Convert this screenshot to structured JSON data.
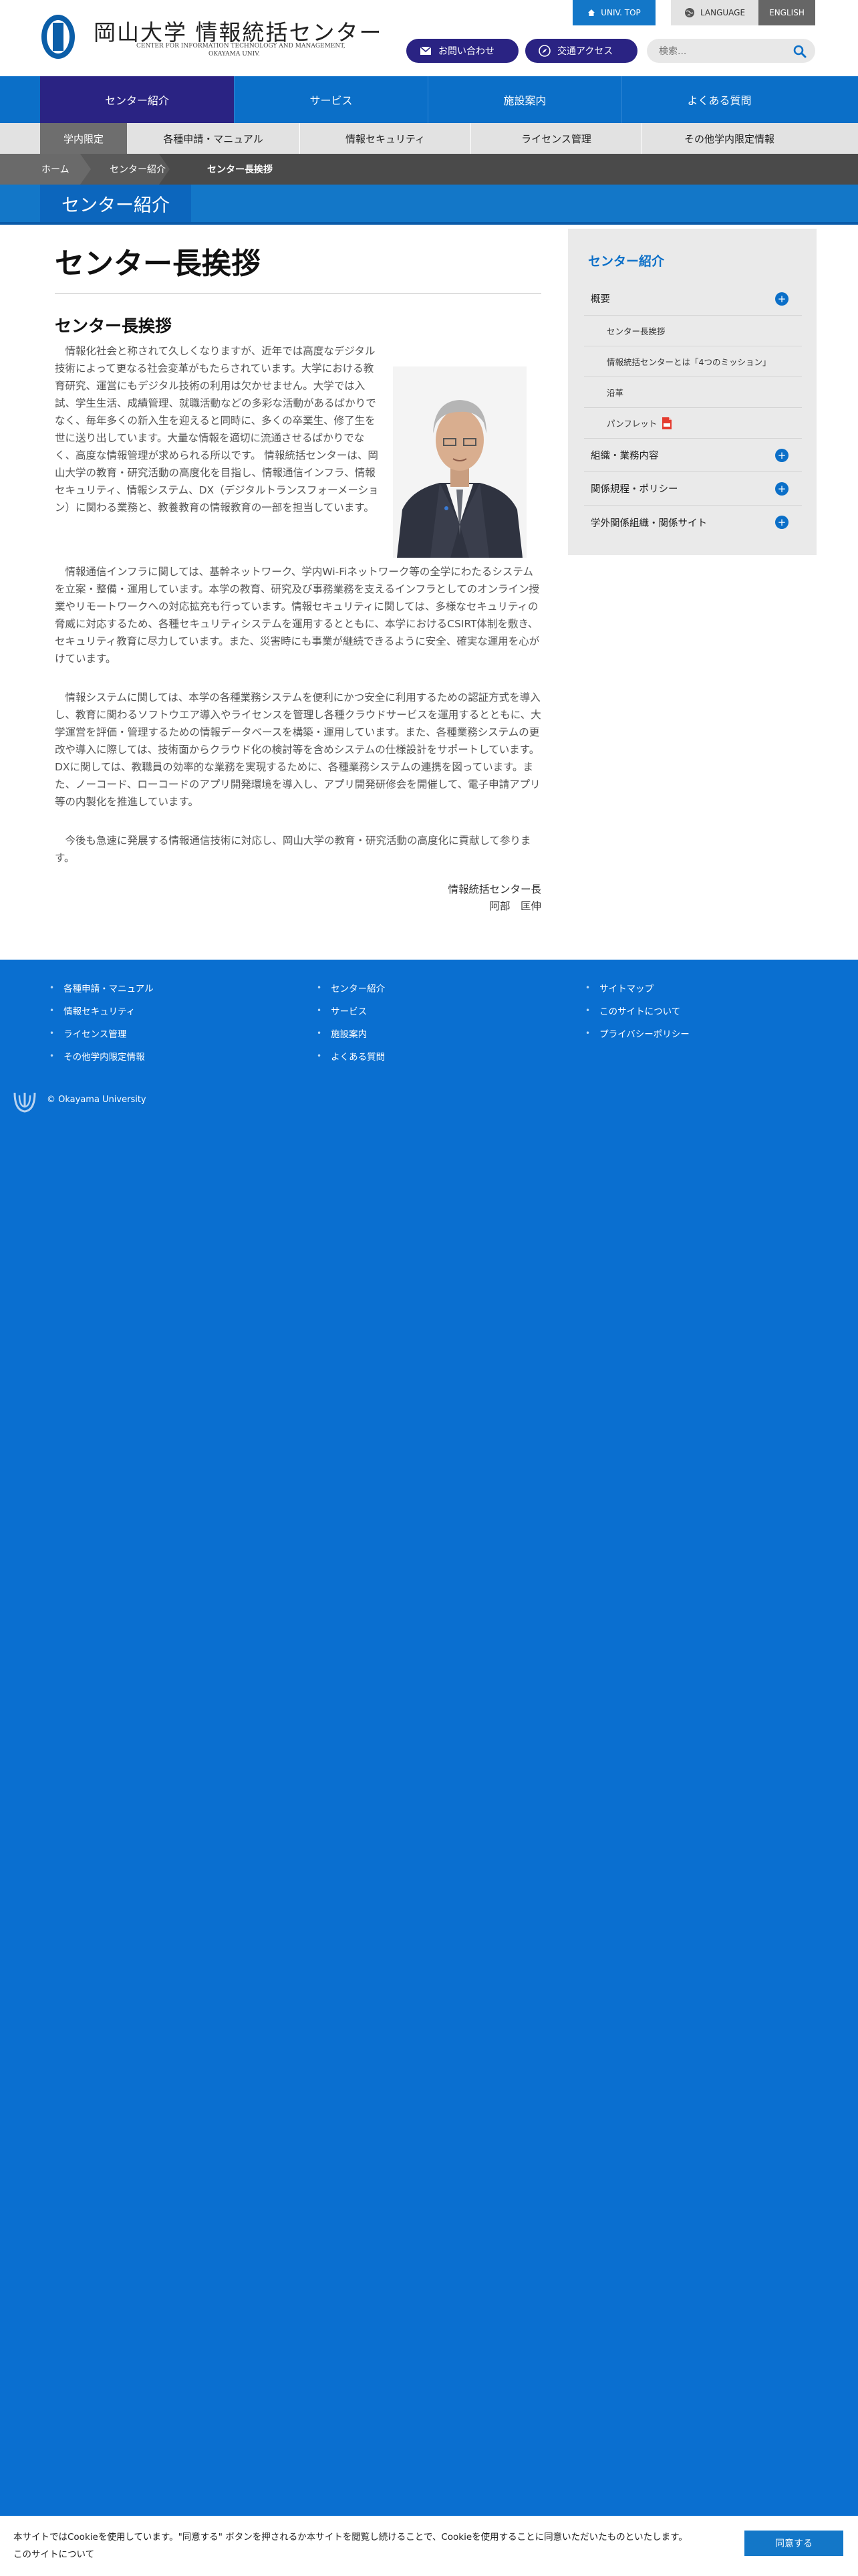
{
  "header": {
    "univ_top": "UNIV. TOP",
    "language": "LANGUAGE",
    "english": "ENGLISH",
    "title": "岡山大学 情報統括センター",
    "subtitle_en_1": "CENTER FOR INFORMATION TECHNOLOGY AND MANAGEMENT,",
    "subtitle_en_2": "OKAYAMA UNIV.",
    "contact": "お問い合わせ",
    "access": "交通アクセス",
    "search_placeholder": "検索..."
  },
  "main_nav": [
    {
      "label": "センター紹介"
    },
    {
      "label": "サービス"
    },
    {
      "label": "施設案内"
    },
    {
      "label": "よくある質問"
    }
  ],
  "sub_nav": [
    {
      "label": "学内限定"
    },
    {
      "label": "各種申請・マニュアル"
    },
    {
      "label": "情報セキュリティ"
    },
    {
      "label": "ライセンス管理"
    },
    {
      "label": "その他学内限定情報"
    }
  ],
  "breadcrumb": [
    "ホーム",
    "センター紹介",
    "センター長挨拶"
  ],
  "section_title": "センター紹介",
  "content": {
    "h1": "センター長挨拶",
    "h2": "センター長挨拶",
    "p1": "情報化社会と称されて久しくなりますが、近年では高度なデジタル技術によって更なる社会変革がもたらされています。大学における教育研究、運営にもデジタル技術の利用は欠かせません。大学では入試、学生生活、成績管理、就職活動などの多彩な活動があるばかりでなく、毎年多くの新入生を迎えると同時に、多くの卒業生、修了生を世に送り出しています。大量な情報を適切に流通させるばかりでなく、高度な情報管理が求められる所以です。 情報統括センターは、岡山大学の教育・研究活動の高度化を目指し、情報通信インフラ、情報セキュリティ、情報システム、DX（デジタルトランスフォーメーション）に関わる業務と、教養教育の情報教育の一部を担当しています。",
    "p2": "情報通信インフラに関しては、基幹ネットワーク、学内Wi-Fiネットワーク等の全学にわたるシステムを立案・整備・運用しています。本学の教育、研究及び事務業務を支えるインフラとしてのオンライン授業やリモートワークへの対応拡充も行っています。情報セキュリティに関しては、多様なセキュリティの脅威に対応するため、各種セキュリティシステムを運用するとともに、本学におけるCSIRT体制を敷き、セキュリティ教育に尽力しています。また、災害時にも事業が継続できるように安全、確実な運用を心がけています。",
    "p3": "情報システムに関しては、本学の各種業務システムを便利にかつ安全に利用するための認証方式を導入し、教育に関わるソフトウエア導入やライセンスを管理し各種クラウドサービスを運用するとともに、大学運営を評価・管理するための情報データベースを構築・運用しています。また、各種業務システムの更改や導入に際しては、技術面からクラウド化の検討等を含めシステムの仕様設計をサポートしています。 DXに関しては、教職員の効率的な業務を実現するために、各種業務システムの連携を図っています。また、ノーコード、ローコードのアプリ開発環境を導入し、アプリ開発研修会を開催して、電子申請アプリ等の内製化を推進しています。",
    "p4": "今後も急速に発展する情報通信技術に対応し、岡山大学の教育・研究活動の高度化に貢献して参ります。",
    "sig_title": "情報統括センター長",
    "sig_name": "阿部　匡伸"
  },
  "sidebar": {
    "title": "センター紹介",
    "items": [
      {
        "label": "概要",
        "level": "top",
        "expand": "+"
      },
      {
        "label": "センター長挨拶",
        "level": "sub"
      },
      {
        "label": "情報統括センターとは「4つのミッション」",
        "level": "sub"
      },
      {
        "label": "沿革",
        "level": "sub"
      },
      {
        "label": "パンフレット",
        "level": "sub",
        "icon": "pdf-icon"
      },
      {
        "label": "組織・業務内容",
        "level": "top",
        "expand": "+"
      },
      {
        "label": "関係規程・ポリシー",
        "level": "top",
        "expand": "+"
      },
      {
        "label": "学外関係組織・関係サイト",
        "level": "top",
        "expand": "+"
      }
    ]
  },
  "footer": {
    "col1": [
      "各種申請・マニュアル",
      "情報セキュリティ",
      "ライセンス管理",
      "その他学内限定情報"
    ],
    "col2": [
      "センター紹介",
      "サービス",
      "施設案内",
      "よくある質問"
    ],
    "col3": [
      "サイトマップ",
      "このサイトについて",
      "プライバシーポリシー"
    ],
    "copyright": "© Okayama University"
  },
  "cookie": {
    "text": "本サイトではCookieを使用しています。\"同意する\" ボタンを押されるか本サイトを閲覧し続けることで、Cookieを使用することに同意いただいたものといたします。",
    "link": "このサイトについて",
    "button": "同意する"
  },
  "colors": {
    "primary_blue": "#0b6fc8",
    "navy": "#2a2383",
    "footer_blue": "#0a6fd0"
  }
}
